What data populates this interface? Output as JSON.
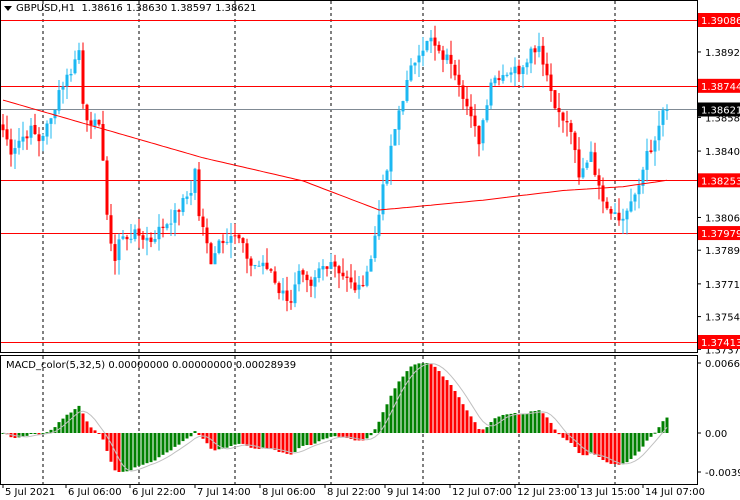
{
  "header": {
    "symbol": "GBPUSD,H1",
    "open": "1.38616",
    "high": "1.38630",
    "low": "1.38597",
    "close": "1.38621"
  },
  "indicator": {
    "name": "MACD_color(5,32,5)",
    "v1": "0.00000000",
    "v2": "0.00000000",
    "v3": "0.00028939"
  },
  "colors": {
    "bull": "#1cb8f2",
    "bear": "#ff0000",
    "level": "#ff0000",
    "current": "#808a94",
    "ma": "#ff0000",
    "macd_up": "#008000",
    "macd_down": "#ff0000",
    "signal": "#c0c0c0"
  },
  "chart_data": {
    "type": "candlestick",
    "title": "GBPUSD,H1",
    "ylim": [
      1.37375,
      1.39086
    ],
    "price_ticks": [
      "1.38920",
      "1.38580",
      "1.38405",
      "1.38060",
      "1.37890",
      "1.37715",
      "1.37545",
      "1.37375"
    ],
    "levels": [
      "1.39086",
      "1.38744",
      "1.38253",
      "1.37979",
      "1.37413"
    ],
    "current_price": "1.38621",
    "macd_ticks": [
      "0.0066599",
      "0.00",
      "-0.003966"
    ],
    "macd_ylim": [
      -0.003966,
      0.0066599
    ],
    "time_labels": [
      "5 Jul 2021",
      "6 Jul 06:00",
      "6 Jul 22:00",
      "7 Jul 14:00",
      "8 Jul 06:00",
      "8 Jul 22:00",
      "9 Jul 14:00",
      "12 Jul 07:00",
      "12 Jul 23:00",
      "13 Jul 15:00",
      "14 Jul 07:00"
    ],
    "candle_count": 167,
    "close_keypoints": [
      [
        0,
        1.38514
      ],
      [
        2,
        1.3841
      ],
      [
        4,
        1.38462
      ],
      [
        7,
        1.38514
      ],
      [
        9,
        1.38462
      ],
      [
        12,
        1.38566
      ],
      [
        14,
        1.38722
      ],
      [
        17,
        1.38826
      ],
      [
        19,
        1.3893
      ],
      [
        20,
        1.3867
      ],
      [
        22,
        1.38514
      ],
      [
        24,
        1.38566
      ],
      [
        25,
        1.38359
      ],
      [
        26,
        1.38047
      ],
      [
        28,
        1.37839
      ],
      [
        29,
        1.37943
      ],
      [
        32,
        1.37969
      ],
      [
        34,
        1.37969
      ],
      [
        37,
        1.37943
      ],
      [
        39,
        1.37995
      ],
      [
        43,
        1.38073
      ],
      [
        47,
        1.38203
      ],
      [
        48,
        1.38307
      ],
      [
        49,
        1.38073
      ],
      [
        52,
        1.37839
      ],
      [
        54,
        1.37943
      ],
      [
        57,
        1.37969
      ],
      [
        59,
        1.37943
      ],
      [
        62,
        1.37813
      ],
      [
        64,
        1.37813
      ],
      [
        67,
        1.37787
      ],
      [
        69,
        1.37683
      ],
      [
        72,
        1.37631
      ],
      [
        74,
        1.37761
      ],
      [
        77,
        1.37683
      ],
      [
        79,
        1.37787
      ],
      [
        82,
        1.37839
      ],
      [
        84,
        1.37787
      ],
      [
        87,
        1.37709
      ],
      [
        89,
        1.37683
      ],
      [
        92,
        1.37839
      ],
      [
        94,
        1.38099
      ],
      [
        97,
        1.3841
      ],
      [
        99,
        1.38618
      ],
      [
        102,
        1.38826
      ],
      [
        104,
        1.3893
      ],
      [
        107,
        1.38982
      ],
      [
        109,
        1.38904
      ],
      [
        112,
        1.38878
      ],
      [
        114,
        1.38774
      ],
      [
        117,
        1.38566
      ],
      [
        119,
        1.38462
      ],
      [
        122,
        1.38774
      ],
      [
        124,
        1.388
      ],
      [
        127,
        1.38826
      ],
      [
        129,
        1.38826
      ],
      [
        132,
        1.3893
      ],
      [
        134,
        1.38956
      ],
      [
        137,
        1.38722
      ],
      [
        139,
        1.38592
      ],
      [
        142,
        1.38514
      ],
      [
        144,
        1.38255
      ],
      [
        146,
        1.38359
      ],
      [
        147,
        1.3841
      ],
      [
        149,
        1.38203
      ],
      [
        152,
        1.38099
      ],
      [
        153,
        1.38099
      ],
      [
        155,
        1.38047
      ],
      [
        157,
        1.38151
      ],
      [
        159,
        1.38203
      ],
      [
        161,
        1.3841
      ],
      [
        163,
        1.38436
      ],
      [
        165,
        1.38618
      ],
      [
        166,
        1.38621
      ]
    ],
    "ma_keypoints": [
      [
        0,
        1.3867
      ],
      [
        25,
        1.3852
      ],
      [
        50,
        1.3837
      ],
      [
        75,
        1.3825
      ],
      [
        94,
        1.38099
      ],
      [
        100,
        1.3811
      ],
      [
        120,
        1.3815
      ],
      [
        140,
        1.382
      ],
      [
        155,
        1.3822
      ],
      [
        166,
        1.38253
      ]
    ]
  }
}
